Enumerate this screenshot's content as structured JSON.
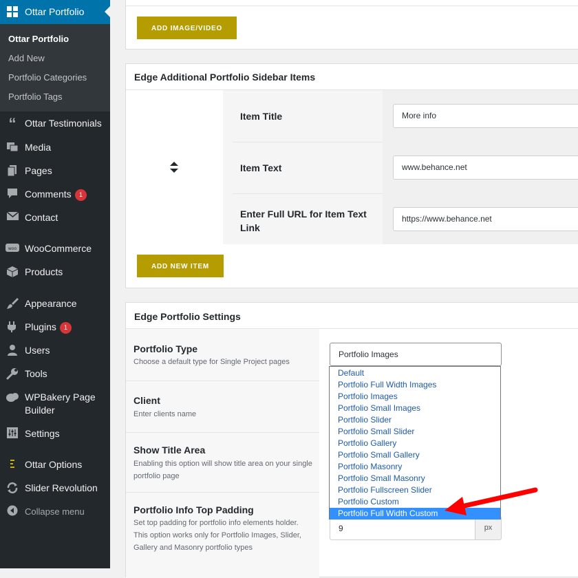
{
  "sidebar": {
    "active_menu": "Ottar Portfolio",
    "submenu": [
      {
        "label": "Ottar Portfolio",
        "current": true
      },
      {
        "label": "Add New"
      },
      {
        "label": "Portfolio Categories"
      },
      {
        "label": "Portfolio Tags"
      }
    ],
    "items": [
      {
        "label": "Ottar Testimonials",
        "icon": "quote-icon"
      },
      {
        "label": "Media",
        "icon": "media-icon"
      },
      {
        "label": "Pages",
        "icon": "pages-icon"
      },
      {
        "label": "Comments",
        "icon": "comments-icon",
        "badge": "1"
      },
      {
        "label": "Contact",
        "icon": "mail-icon"
      },
      {
        "label": "WooCommerce",
        "icon": "woo-icon"
      },
      {
        "label": "Products",
        "icon": "box-icon"
      },
      {
        "label": "Appearance",
        "icon": "brush-icon"
      },
      {
        "label": "Plugins",
        "icon": "plugin-icon",
        "badge": "1"
      },
      {
        "label": "Users",
        "icon": "users-icon"
      },
      {
        "label": "Tools",
        "icon": "wrench-icon"
      },
      {
        "label": "WPBakery Page Builder",
        "icon": "wpbakery-icon"
      },
      {
        "label": "Settings",
        "icon": "sliders-icon"
      },
      {
        "label": "Ottar Options",
        "icon": "ottar-options-icon"
      },
      {
        "label": "Slider Revolution",
        "icon": "refresh-icon"
      },
      {
        "label": "Collapse menu",
        "icon": "collapse-icon"
      }
    ],
    "accent_color": "#0073aa",
    "badge_color": "#d63638"
  },
  "top_panel": {
    "add_media_label": "ADD IMAGE/VIDEO"
  },
  "sidebar_items_panel": {
    "title": "Edge Additional Portfolio Sidebar Items",
    "fields": [
      {
        "label": "Item Title",
        "value": "More info"
      },
      {
        "label": "Item Text",
        "value": "www.behance.net"
      },
      {
        "label": "Enter Full URL for Item Text Link",
        "value": "https://www.behance.net"
      }
    ],
    "add_item_label": "ADD NEW ITEM",
    "button_color": "#b59c00"
  },
  "portfolio_settings": {
    "title": "Edge Portfolio Settings",
    "portfolio_type": {
      "label": "Portfolio Type",
      "description": "Choose a default type for Single Project pages",
      "selected": "Portfolio Images",
      "options": [
        "Default",
        "Portfolio Full Width Images",
        "Portfolio Images",
        "Portfolio Small Images",
        "Portfolio Slider",
        "Portfolio Small Slider",
        "Portfolio Gallery",
        "Portfolio Small Gallery",
        "Portfolio Masonry",
        "Portfolio Small Masonry",
        "Portfolio Fullscreen Slider",
        "Portfolio Custom",
        "Portfolio Full Width Custom"
      ],
      "highlighted_option": "Portfolio Full Width Custom"
    },
    "client": {
      "label": "Client",
      "description": "Enter clients name"
    },
    "show_title_area": {
      "label": "Show Title Area",
      "description": "Enabling this option will show title area on your single portfolio page"
    },
    "info_top_padding": {
      "label": "Portfolio Info Top Padding",
      "description": "Set top padding for portfolio info elements holder. This option works only for Portfolio Images, Slider, Gallery and Masonry portfolio types",
      "value": "9",
      "unit": "px"
    }
  },
  "annotation": {
    "arrow_color": "#ff0000"
  }
}
